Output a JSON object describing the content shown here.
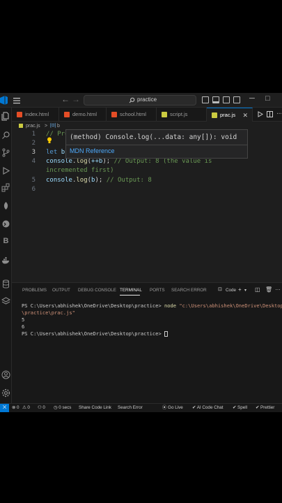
{
  "titlebar": {
    "search_text": "practice"
  },
  "tabs": [
    {
      "label": "index.html",
      "icon_color": "#e44d26"
    },
    {
      "label": "demo.html",
      "icon_color": "#e44d26"
    },
    {
      "label": "school.html",
      "icon_color": "#e44d26"
    },
    {
      "label": "script.js",
      "icon_color": "#cbcb41"
    },
    {
      "label": "prac.js",
      "icon_color": "#cbcb41",
      "active": true,
      "close": "✕"
    }
  ],
  "breadcrumb": {
    "file": "prac.js",
    "sep": ">",
    "symbol": "b"
  },
  "editor": {
    "line_numbers": [
      "1",
      "2",
      "3",
      "4",
      "5",
      "6"
    ],
    "line1_comment": "// Pre-i",
    "line3_kw": "let",
    "line3_var": "b",
    "line3_op": " = ",
    "line4_obj": "console",
    "line4_fn": "log",
    "line4_arg": "++b",
    "line4_comment": "// Output: 8 (the value is",
    "line4_comment_wrap": "incremented first)",
    "line5_obj": "console",
    "line5_fn": "log",
    "line5_arg": "b",
    "line5_comment": "// Output: 8"
  },
  "hover": {
    "kind": "(method)",
    "signature": " Console.log(...data: any[]): void",
    "link": "MDN Reference"
  },
  "panel": {
    "tabs": [
      "PROBLEMS",
      "OUTPUT",
      "DEBUG CONSOLE",
      "TERMINAL",
      "PORTS",
      "SEARCH ERROR"
    ],
    "active_tab": "TERMINAL",
    "shell_label": "Code"
  },
  "terminal": {
    "prompt1": "PS C:\\Users\\abhishek\\OneDrive\\Desktop\\practice> ",
    "cmd": "node",
    "arg": " \"c:\\Users\\abhishek\\OneDrive\\Desktop",
    "arg_wrap": "\\practice\\prac.js\"",
    "out1": "5",
    "out2": "6",
    "prompt2": "PS C:\\Users\\abhishek\\OneDrive\\Desktop\\practice> "
  },
  "status": {
    "errors": "0",
    "warnings": "0",
    "ports": "0",
    "timer": "0 secs",
    "share": "Share Code Link",
    "search_error": "Search Error",
    "golive": "Go Live",
    "ai_chat": "AI Code Chat",
    "spell": "Spell",
    "prettier": "Prettier"
  }
}
